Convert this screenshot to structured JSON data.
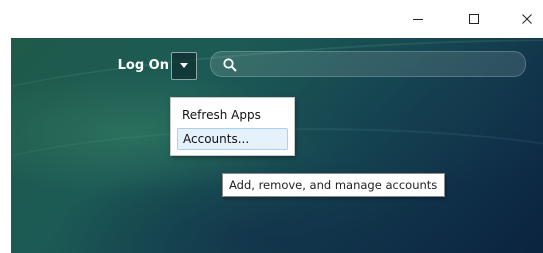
{
  "titlebar": {
    "minimize_icon": "minimize-icon",
    "maximize_icon": "maximize-icon",
    "close_icon": "close-icon"
  },
  "toolbar": {
    "logon_label": "Log On",
    "dropdown_icon": "caret-down-icon",
    "search": {
      "icon": "search-icon",
      "value": "",
      "placeholder": ""
    }
  },
  "menu": {
    "items": [
      {
        "label": "Refresh Apps"
      },
      {
        "label": "Accounts...",
        "highlighted": true
      }
    ]
  },
  "tooltip": {
    "text": "Add, remove, and manage accounts"
  },
  "colors": {
    "background_dark": "#0f2f48",
    "background_green": "#1f5a4a",
    "menu_highlight": "#e5f1fb",
    "menu_highlight_border": "#a9d2f2"
  }
}
